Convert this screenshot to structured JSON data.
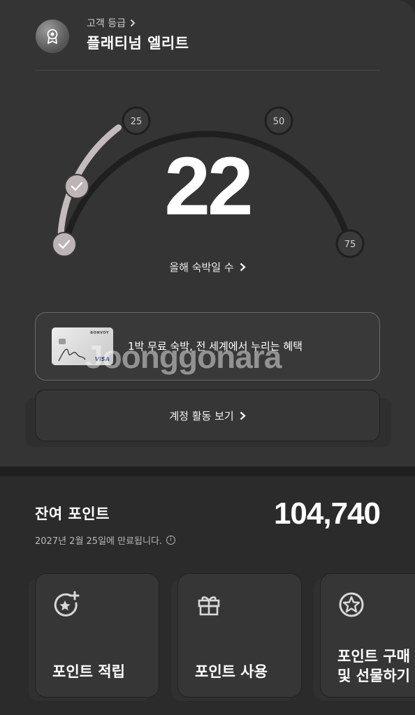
{
  "tier": {
    "caption": "고객 등급",
    "name": "플래티넘 엘리트"
  },
  "gauge": {
    "value": "22",
    "milestones": [
      "25",
      "50",
      "75"
    ],
    "link_label": "올해 숙박일 수",
    "progress_nights": 22,
    "max_nights": 75
  },
  "promo": {
    "text": "1박 무료 숙박, 전 세계에서 누리는 혜택",
    "card_brand": "BONVOY",
    "card_network": "VISA"
  },
  "watermark": "Joonggonara",
  "activity": {
    "label": "계정 활동 보기"
  },
  "points": {
    "label": "잔여 포인트",
    "value": "104,740",
    "expiry": "2027년 2월 25일에 만료됩니다."
  },
  "tiles": [
    {
      "label_lines": [
        "포인트 적립"
      ],
      "icon": "star-plus-icon"
    },
    {
      "label_lines": [
        "포인트 사용"
      ],
      "icon": "gift-icon"
    },
    {
      "label_lines": [
        "포인트 구매",
        "및 선물하기"
      ],
      "icon": "star-badge-icon"
    }
  ],
  "colors": {
    "background": "#2b2b2b",
    "card": "#343434",
    "gauge_track": "#1f1f1f",
    "gauge_progress": "#c4bcbc"
  }
}
